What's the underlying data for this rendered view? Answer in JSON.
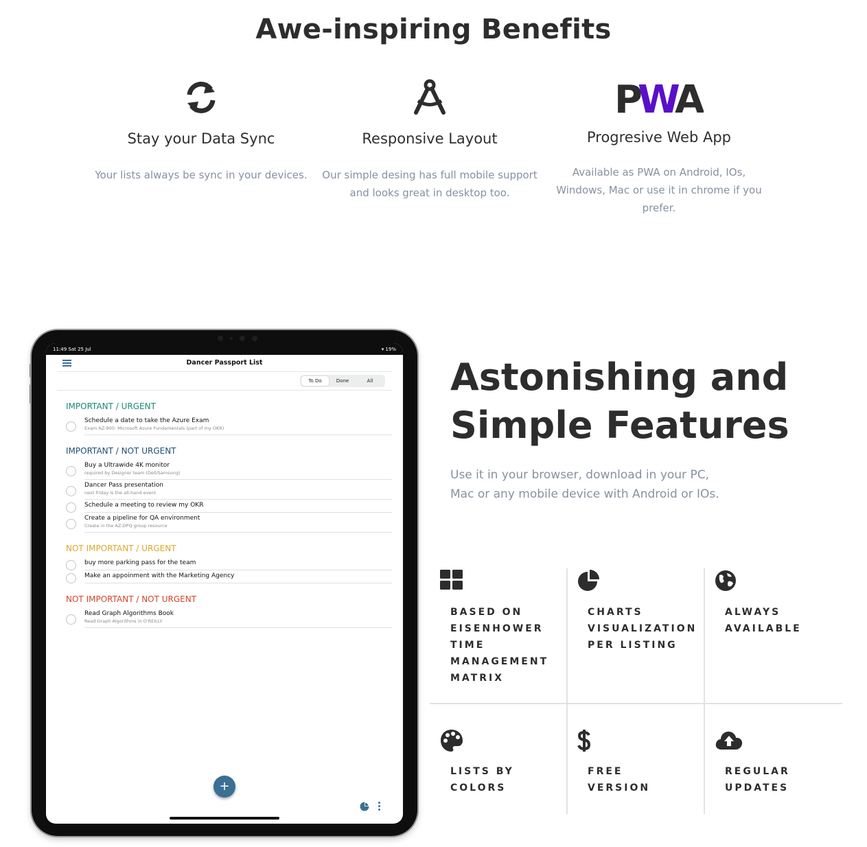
{
  "benefits": {
    "title": "Awe-inspiring Benefits",
    "items": [
      {
        "icon": "sync-icon",
        "title": "Stay your Data Sync",
        "desc": "Your lists always be sync in your devices."
      },
      {
        "icon": "compass-icon",
        "title": "Responsive Layout",
        "desc": "Our simple desing has full mobile support and looks great in desktop too."
      },
      {
        "icon": "pwa-logo",
        "title": "Progresive Web App",
        "desc": "Available as PWA on Android, IOs, Windows, Mac or use it in chrome if you prefer."
      }
    ],
    "pwa_logo_text": "PWA"
  },
  "tablet": {
    "status_time": "11:49  Sat 25 Jul",
    "status_battery": "▾ 19%",
    "app_title": "Dancer Passport List",
    "tabs": [
      "To Do",
      "Done",
      "All"
    ],
    "active_tab": "To Do",
    "sections": [
      {
        "title": "IMPORTANT / URGENT",
        "color": "#1a8a74",
        "tasks": [
          {
            "title": "Schedule a date to take the Azure Exam",
            "subtitle": "Exam AZ-900: Microsoft Azure Fundamentals (part of my OKR)"
          }
        ]
      },
      {
        "title": "IMPORTANT / NOT URGENT",
        "color": "#1f4f73",
        "tasks": [
          {
            "title": "Buy a Ultrawide 4K monitor",
            "subtitle": "required by Designer team (Dell/Samsung)"
          },
          {
            "title": "Dancer Pass presentation",
            "subtitle": "next friday is the all-hand event"
          },
          {
            "title": "Schedule a meeting to review my OKR",
            "subtitle": ""
          },
          {
            "title": "Create a pipeline for QA environment",
            "subtitle": "Create in the AZ-DPQ group resource"
          }
        ]
      },
      {
        "title": "NOT IMPORTANT / URGENT",
        "color": "#d8a92a",
        "tasks": [
          {
            "title": "buy more parking pass for the team",
            "subtitle": ""
          },
          {
            "title": "Make an appoinment with the Marketing Agency",
            "subtitle": ""
          }
        ]
      },
      {
        "title": "NOT IMPORTANT / NOT URGENT",
        "color": "#d2452b",
        "tasks": [
          {
            "title": "Read Graph Algorithms Book",
            "subtitle": "Read Graph Algorithms in O'REILLY"
          }
        ]
      }
    ],
    "fab_label": "+"
  },
  "features": {
    "title_line1": "Astonishing and",
    "title_line2": "Simple Features",
    "subtitle_line1": "Use it in your browser, download in your PC,",
    "subtitle_line2": "Mac or any mobile device with Android or IOs.",
    "items": [
      {
        "icon": "grid-icon",
        "label": "Based on Eisenhower Time Management Matrix"
      },
      {
        "icon": "pie-chart-icon",
        "label": "Charts Visualization per listing"
      },
      {
        "icon": "globe-icon",
        "label": "Always Available"
      },
      {
        "icon": "palette-icon",
        "label": "Lists by colors"
      },
      {
        "icon": "dollar-icon",
        "label": "Free version"
      },
      {
        "icon": "cloud-upload-icon",
        "label": "Regular updates"
      }
    ]
  },
  "colors": {
    "heading": "#2d2d2d",
    "muted": "#8791a0",
    "accent_blue": "#3b6f93",
    "pwa_purple": "#5a0fc8"
  }
}
